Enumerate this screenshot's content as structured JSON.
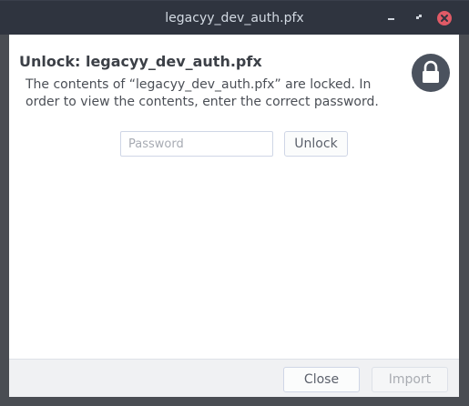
{
  "window": {
    "title": "legacyy_dev_auth.pfx"
  },
  "dialog": {
    "heading": "Unlock: legacyy_dev_auth.pfx",
    "description": "The contents of “legacyy_dev_auth.pfx” are locked. In order to view the contents, enter the correct password.",
    "lock_icon": "lock-icon"
  },
  "password": {
    "value": "",
    "placeholder": "Password"
  },
  "buttons": {
    "unlock_label": "Unlock",
    "close_label": "Close",
    "import_label": "Import"
  },
  "colors": {
    "titlebar": "#2f343f",
    "close_button": "#e05a66",
    "lock_icon_bg": "#4b525e"
  }
}
